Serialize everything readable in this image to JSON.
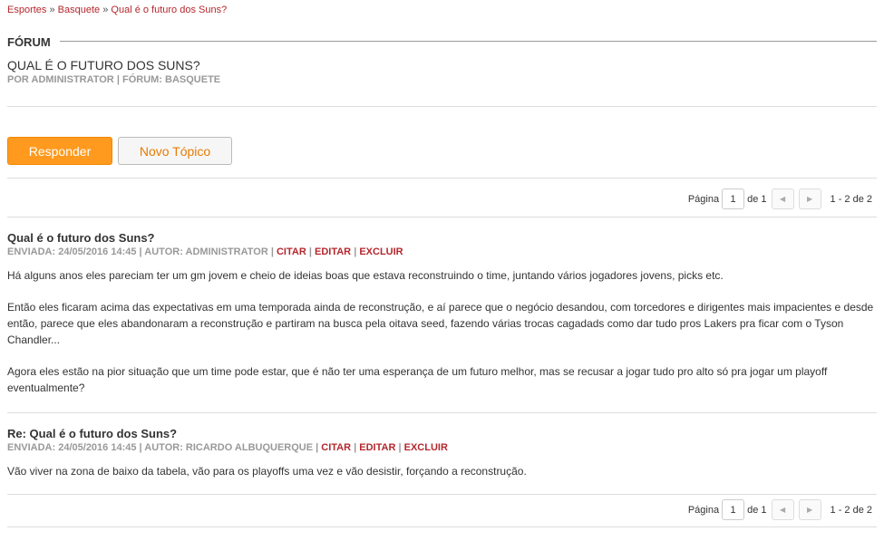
{
  "breadcrumb": {
    "items": [
      "Esportes",
      "Basquete",
      "Qual é o futuro dos Suns?"
    ],
    "separator": "»"
  },
  "section": {
    "title": "FÓRUM"
  },
  "topic": {
    "title": "QUAL É O FUTURO DOS SUNS?",
    "meta_by_label": "POR",
    "author": "ADMINISTRATOR",
    "forum_label": "FÓRUM:",
    "forum": "BASQUETE"
  },
  "actions": {
    "reply": "Responder",
    "new_topic": "Novo Tópico"
  },
  "pagination": {
    "page_label": "Página",
    "current_page": "1",
    "of_label": "de 1",
    "range": "1 - 2 de 2"
  },
  "meta_labels": {
    "sent": "ENVIADA:",
    "author": "AUTOR:",
    "quote": "CITAR",
    "edit": "EDITAR",
    "delete": "EXCLUIR"
  },
  "posts": [
    {
      "title": "Qual é o futuro dos Suns?",
      "date": "24/05/2016 14:45",
      "author": "ADMINISTRATOR",
      "paragraphs": [
        "Há alguns anos eles pareciam ter um gm jovem e cheio de ideias boas que estava reconstruindo o time, juntando vários jogadores jovens, picks etc.",
        "Então eles ficaram acima das expectativas em uma temporada ainda de reconstrução, e aí parece que o negócio desandou, com torcedores e dirigentes mais impacientes e desde então, parece que eles abandonaram a reconstrução e partiram na busca pela oitava seed, fazendo várias trocas cagadads como dar tudo pros Lakers pra ficar com o Tyson Chandler...",
        "Agora eles estão na pior situação que um time pode estar, que é não ter uma esperança de um futuro melhor, mas se recusar a jogar tudo pro alto só pra jogar um playoff eventualmente?"
      ]
    },
    {
      "title": "Re: Qual é o futuro dos Suns?",
      "date": "24/05/2016 14:45",
      "author": "RICARDO ALBUQUERQUE",
      "paragraphs": [
        "Vão viver na zona de baixo da tabela, vão para os playoffs uma vez e vão desistir, forçando a reconstrução."
      ]
    }
  ],
  "colors": {
    "accent": "#ff9a1e",
    "link": "#b5272d",
    "meta": "#999999"
  },
  "icons": {
    "prev": "caret-left-icon",
    "next": "caret-right-icon"
  }
}
